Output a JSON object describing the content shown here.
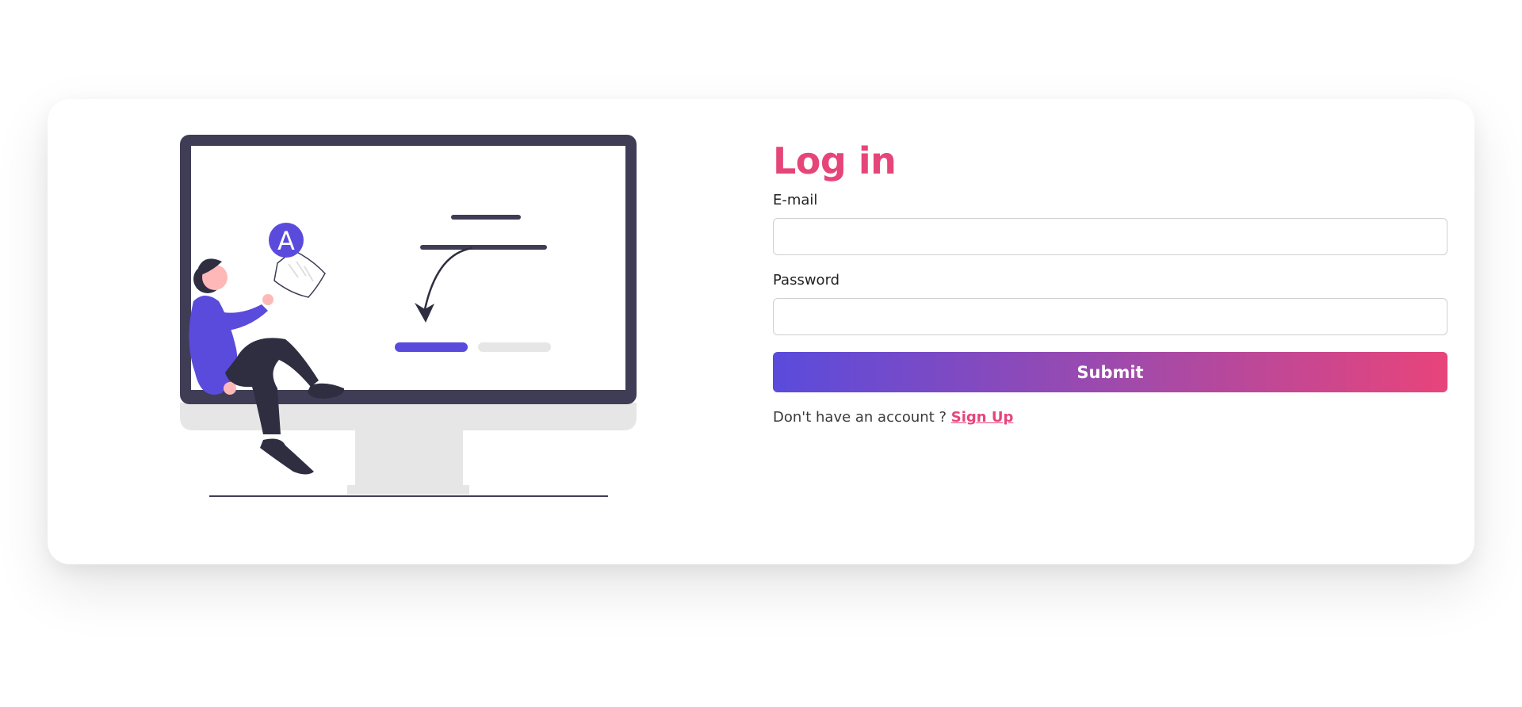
{
  "login": {
    "title": "Log in",
    "email_label": "E-mail",
    "email_value": "",
    "password_label": "Password",
    "password_value": "",
    "submit_label": "Submit",
    "signup_prompt": "Don't have an account ?",
    "signup_link": "Sign Up"
  },
  "illustration": {
    "avatar_letter": "A"
  },
  "colors": {
    "accent_pink": "#e6457a",
    "accent_purple": "#5a4bdc",
    "monitor_dark": "#3f3d56",
    "monitor_stand": "#e6e6e6"
  }
}
